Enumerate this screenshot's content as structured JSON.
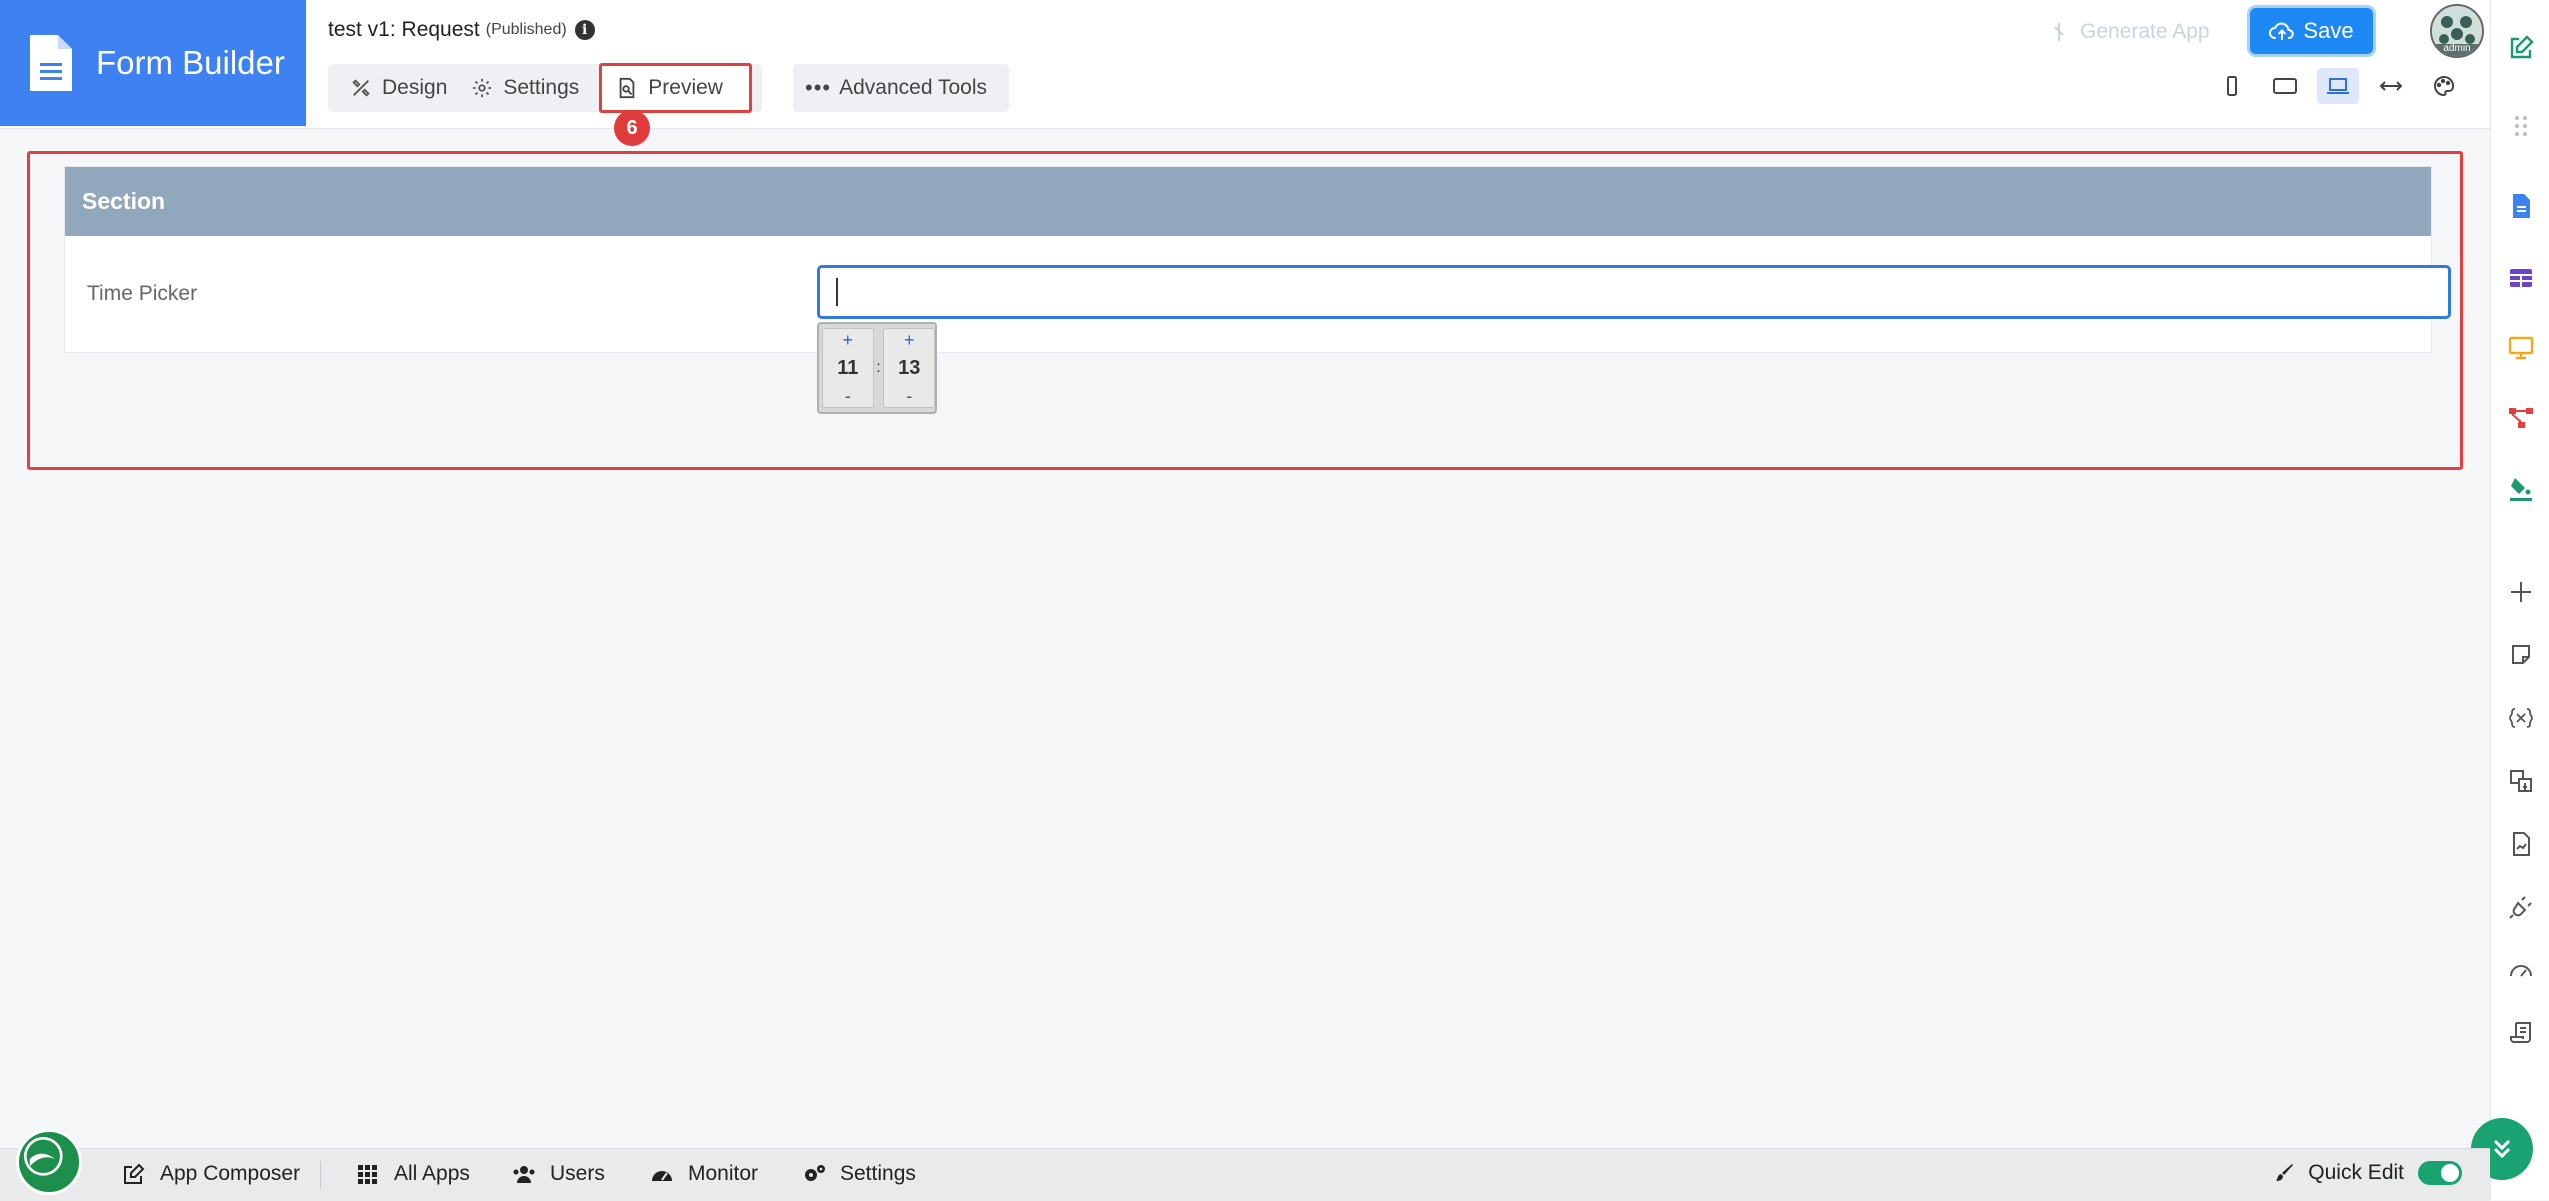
{
  "brand": {
    "title": "Form Builder"
  },
  "form": {
    "name": "test v1: Request",
    "status": "(Published)",
    "info_icon": "i"
  },
  "tabs": [
    {
      "label": "Design",
      "icon": "design-icon"
    },
    {
      "label": "Settings",
      "icon": "gear-icon"
    },
    {
      "label": "Preview",
      "icon": "preview-icon"
    }
  ],
  "advanced_tools": {
    "label": "Advanced Tools"
  },
  "step_badge": "6",
  "toolbar": {
    "generate_label": "Generate App",
    "save_label": "Save"
  },
  "user": {
    "name": "admin"
  },
  "device_modes": [
    "mobile-icon",
    "tablet-icon",
    "laptop-icon",
    "fit-width-icon",
    "palette-icon"
  ],
  "section": {
    "title": "Section",
    "field_label": "Time Picker",
    "time_value": "",
    "hours": "11",
    "minutes": "13",
    "separator": ":",
    "plus": "+",
    "minus": "-"
  },
  "footer": {
    "nav": [
      {
        "label": "App Composer",
        "icon": "edit-icon"
      },
      {
        "label": "All Apps",
        "icon": "grid-icon"
      },
      {
        "label": "Users",
        "icon": "users-icon"
      },
      {
        "label": "Monitor",
        "icon": "gauge-icon"
      },
      {
        "label": "Settings",
        "icon": "cogs-icon"
      }
    ],
    "quick_edit_label": "Quick Edit",
    "quick_edit_on": true
  },
  "colors": {
    "brand": "#3d82f0",
    "save": "#1e88f5",
    "highlight": "#e04040",
    "section_header": "#91a7bb",
    "fab": "#1aa372"
  }
}
